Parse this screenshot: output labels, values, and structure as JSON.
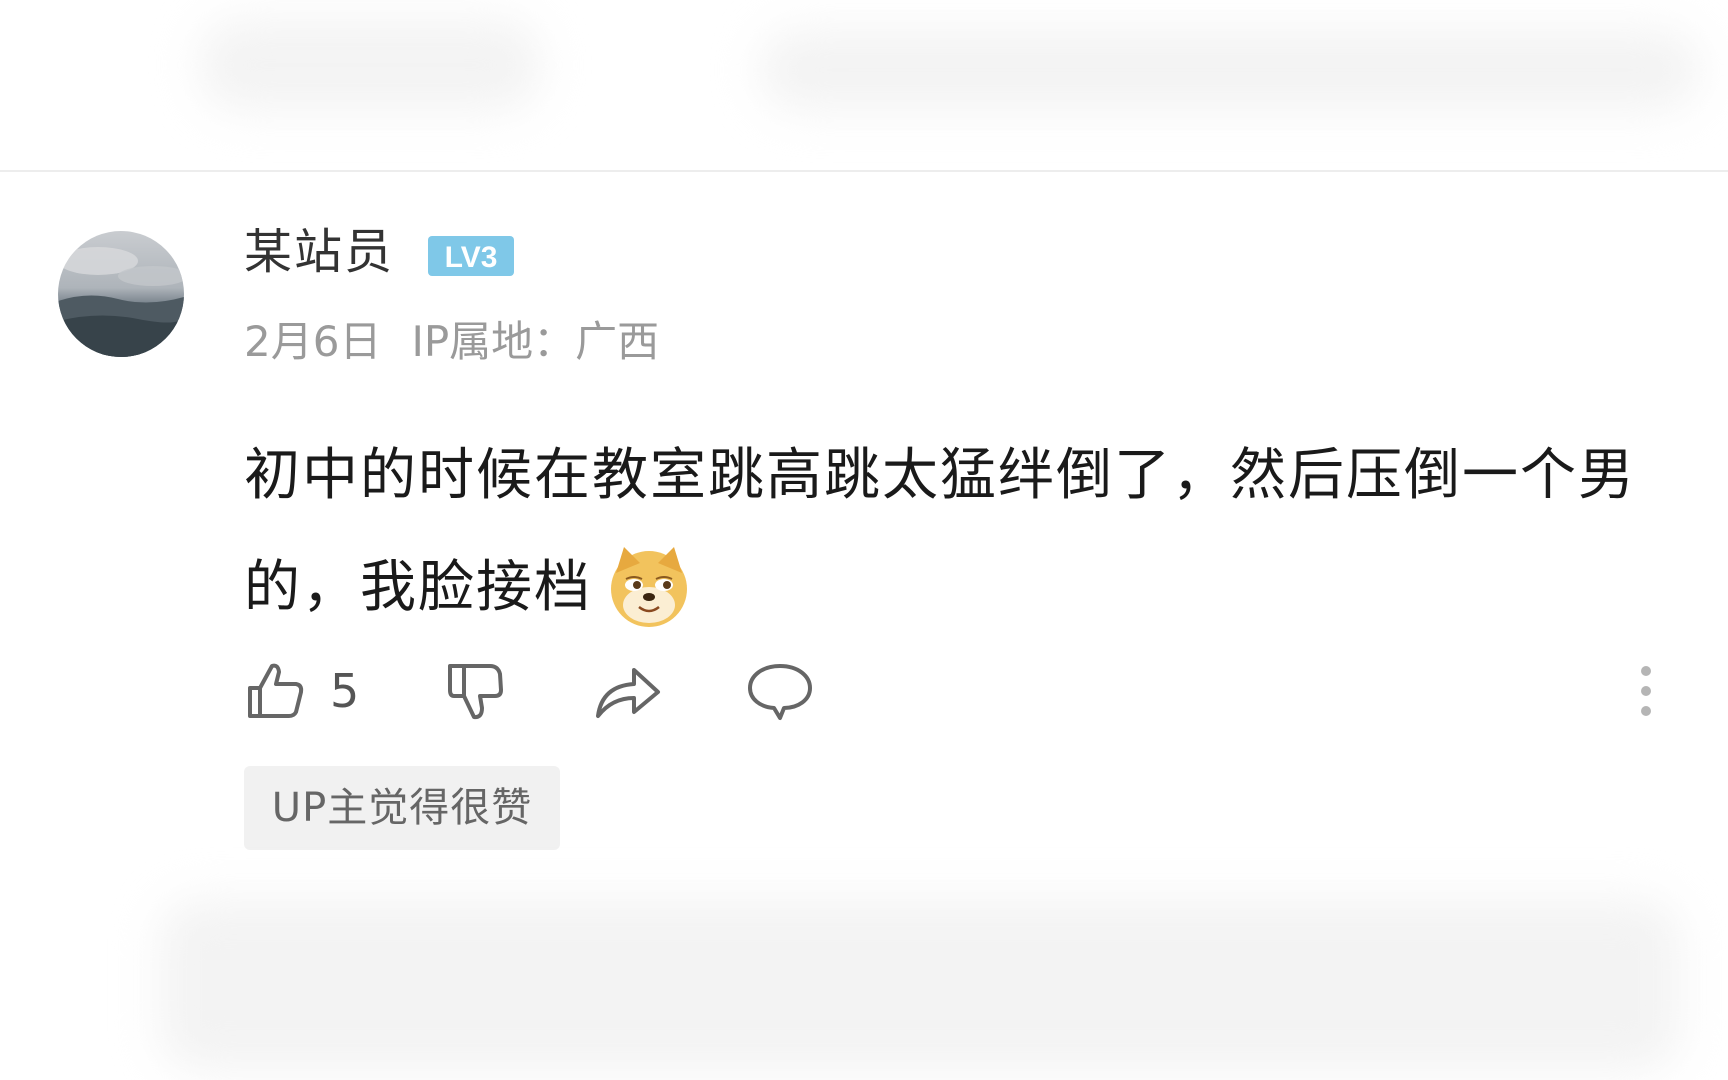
{
  "comment": {
    "username": "某站员",
    "level_badge": "LV3",
    "date": "2月6日",
    "ip_location": "IP属地：广西",
    "text": "初中的时候在教室跳高跳太猛绊倒了，然后压倒一个男的，我脸接档",
    "emoji": "doge-emoji",
    "like_count": "5",
    "up_tag": "UP主觉得很赞"
  },
  "icons": {
    "like": "thumb-up-icon",
    "dislike": "thumb-down-icon",
    "share": "share-icon",
    "reply": "reply-bubble-icon",
    "more": "more-vertical-icon"
  },
  "colors": {
    "level_badge": "#7fc8e8",
    "text_primary": "#1a1a1a",
    "text_secondary": "#9a9a9a",
    "icon": "#666666"
  }
}
